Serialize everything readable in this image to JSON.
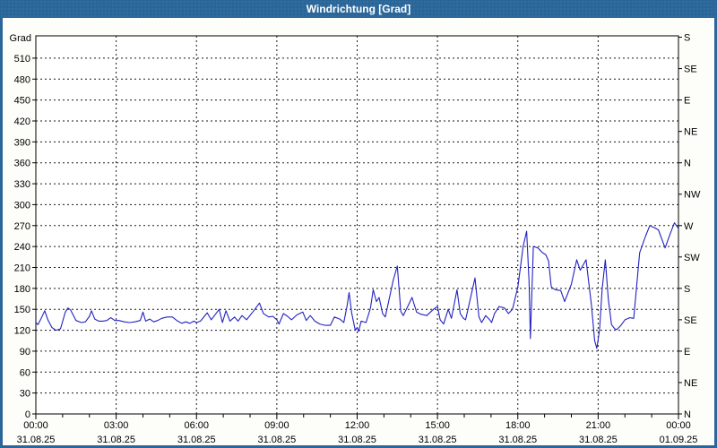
{
  "window": {
    "title": "Windrichtung [Grad]"
  },
  "colors": {
    "titlebar_bg": "#2a6699",
    "frame": "#2a6699",
    "background": "#fdfdf9",
    "plot_background": "#ffffff",
    "axis": "#000000",
    "grid": "#1a1a1a",
    "text": "#000000",
    "title_text": "#ffffff",
    "series": "#2222c0"
  },
  "chart_data": {
    "type": "line",
    "title": "Windrichtung [Grad]",
    "ylabel_left": "Grad",
    "ylim": [
      0,
      542
    ],
    "xlim_hours": [
      0,
      24
    ],
    "grid": "dashed",
    "y_ticks_left": [
      510,
      480,
      450,
      420,
      390,
      360,
      330,
      300,
      270,
      240,
      210,
      180,
      150,
      120,
      90,
      60,
      30,
      0
    ],
    "y_ticks_right": [
      {
        "deg": 540,
        "label": "S"
      },
      {
        "deg": 495,
        "label": "SE"
      },
      {
        "deg": 450,
        "label": "E"
      },
      {
        "deg": 405,
        "label": "NE"
      },
      {
        "deg": 360,
        "label": "N"
      },
      {
        "deg": 315,
        "label": "NW"
      },
      {
        "deg": 270,
        "label": "W"
      },
      {
        "deg": 225,
        "label": "SW"
      },
      {
        "deg": 180,
        "label": "S"
      },
      {
        "deg": 135,
        "label": "SE"
      },
      {
        "deg": 90,
        "label": "E"
      },
      {
        "deg": 45,
        "label": "NE"
      },
      {
        "deg": 0,
        "label": "N"
      }
    ],
    "x_major_ticks": [
      {
        "hour": 0,
        "time": "00:00",
        "date": "31.08.25"
      },
      {
        "hour": 3,
        "time": "03:00",
        "date": "31.08.25"
      },
      {
        "hour": 6,
        "time": "06:00",
        "date": "31.08.25"
      },
      {
        "hour": 9,
        "time": "09:00",
        "date": "31.08.25"
      },
      {
        "hour": 12,
        "time": "12:00",
        "date": "31.08.25"
      },
      {
        "hour": 15,
        "time": "15:00",
        "date": "31.08.25"
      },
      {
        "hour": 18,
        "time": "18:00",
        "date": "31.08.25"
      },
      {
        "hour": 21,
        "time": "21:00",
        "date": "31.08.25"
      },
      {
        "hour": 24,
        "time": "00:00",
        "date": "01.09.25"
      }
    ],
    "x_minor_interval_hours": 1,
    "series": [
      {
        "name": "Windrichtung [Grad]",
        "color": "#2222c0",
        "points": [
          [
            0.0,
            131
          ],
          [
            0.08,
            128
          ],
          [
            0.2,
            137
          ],
          [
            0.33,
            148
          ],
          [
            0.45,
            135
          ],
          [
            0.6,
            124
          ],
          [
            0.75,
            120
          ],
          [
            0.92,
            122
          ],
          [
            1.1,
            146
          ],
          [
            1.2,
            152
          ],
          [
            1.3,
            149
          ],
          [
            1.5,
            134
          ],
          [
            1.7,
            131
          ],
          [
            1.85,
            132
          ],
          [
            2.0,
            140
          ],
          [
            2.08,
            148
          ],
          [
            2.2,
            136
          ],
          [
            2.35,
            133
          ],
          [
            2.5,
            133
          ],
          [
            2.65,
            134
          ],
          [
            2.8,
            138
          ],
          [
            2.95,
            134
          ],
          [
            3.1,
            134
          ],
          [
            3.3,
            132
          ],
          [
            3.5,
            131
          ],
          [
            3.7,
            132
          ],
          [
            3.9,
            134
          ],
          [
            4.0,
            146
          ],
          [
            4.1,
            133
          ],
          [
            4.25,
            136
          ],
          [
            4.4,
            132
          ],
          [
            4.55,
            134
          ],
          [
            4.7,
            137
          ],
          [
            4.9,
            139
          ],
          [
            5.1,
            139
          ],
          [
            5.3,
            133
          ],
          [
            5.45,
            130
          ],
          [
            5.6,
            132
          ],
          [
            5.75,
            130
          ],
          [
            5.9,
            133
          ],
          [
            6.0,
            131
          ],
          [
            6.15,
            133
          ],
          [
            6.4,
            145
          ],
          [
            6.55,
            135
          ],
          [
            6.85,
            150
          ],
          [
            6.97,
            131
          ],
          [
            7.1,
            148
          ],
          [
            7.25,
            133
          ],
          [
            7.42,
            139
          ],
          [
            7.55,
            133
          ],
          [
            7.7,
            141
          ],
          [
            7.87,
            135
          ],
          [
            8.1,
            146
          ],
          [
            8.35,
            159
          ],
          [
            8.5,
            144
          ],
          [
            8.7,
            139
          ],
          [
            8.85,
            140
          ],
          [
            9.0,
            135
          ],
          [
            9.08,
            129
          ],
          [
            9.25,
            144
          ],
          [
            9.4,
            140
          ],
          [
            9.55,
            135
          ],
          [
            9.75,
            142
          ],
          [
            9.97,
            146
          ],
          [
            10.1,
            134
          ],
          [
            10.25,
            141
          ],
          [
            10.42,
            133
          ],
          [
            10.6,
            129
          ],
          [
            10.8,
            127
          ],
          [
            11.0,
            127
          ],
          [
            11.15,
            139
          ],
          [
            11.35,
            136
          ],
          [
            11.5,
            131
          ],
          [
            11.63,
            156
          ],
          [
            11.7,
            174
          ],
          [
            11.8,
            144
          ],
          [
            11.93,
            120
          ],
          [
            12.0,
            124
          ],
          [
            12.05,
            118
          ],
          [
            12.15,
            133
          ],
          [
            12.33,
            131
          ],
          [
            12.5,
            152
          ],
          [
            12.6,
            178
          ],
          [
            12.72,
            161
          ],
          [
            12.82,
            167
          ],
          [
            12.95,
            144
          ],
          [
            13.05,
            139
          ],
          [
            13.2,
            165
          ],
          [
            13.35,
            192
          ],
          [
            13.5,
            212
          ],
          [
            13.63,
            147
          ],
          [
            13.72,
            141
          ],
          [
            13.9,
            155
          ],
          [
            14.05,
            167
          ],
          [
            14.22,
            146
          ],
          [
            14.38,
            143
          ],
          [
            14.6,
            141
          ],
          [
            14.85,
            150
          ],
          [
            15.0,
            154
          ],
          [
            15.1,
            135
          ],
          [
            15.23,
            129
          ],
          [
            15.4,
            150
          ],
          [
            15.52,
            137
          ],
          [
            15.73,
            178
          ],
          [
            15.85,
            144
          ],
          [
            15.97,
            137
          ],
          [
            16.05,
            135
          ],
          [
            16.4,
            195
          ],
          [
            16.55,
            139
          ],
          [
            16.65,
            131
          ],
          [
            16.8,
            141
          ],
          [
            16.95,
            135
          ],
          [
            17.02,
            131
          ],
          [
            17.13,
            144
          ],
          [
            17.3,
            154
          ],
          [
            17.5,
            152
          ],
          [
            17.65,
            144
          ],
          [
            17.8,
            150
          ],
          [
            18.0,
            182
          ],
          [
            18.2,
            240
          ],
          [
            18.33,
            262
          ],
          [
            18.42,
            190
          ],
          [
            18.47,
            108
          ],
          [
            18.58,
            240
          ],
          [
            18.75,
            238
          ],
          [
            18.9,
            232
          ],
          [
            19.05,
            228
          ],
          [
            19.15,
            219
          ],
          [
            19.25,
            182
          ],
          [
            19.4,
            178
          ],
          [
            19.6,
            177
          ],
          [
            19.75,
            161
          ],
          [
            20.0,
            186
          ],
          [
            20.2,
            221
          ],
          [
            20.33,
            206
          ],
          [
            20.55,
            221
          ],
          [
            20.75,
            156
          ],
          [
            20.87,
            105
          ],
          [
            20.95,
            94
          ],
          [
            21.05,
            120
          ],
          [
            21.15,
            180
          ],
          [
            21.27,
            221
          ],
          [
            21.38,
            165
          ],
          [
            21.5,
            128
          ],
          [
            21.62,
            122
          ],
          [
            21.7,
            121
          ],
          [
            21.85,
            127
          ],
          [
            22.0,
            135
          ],
          [
            22.18,
            138
          ],
          [
            22.33,
            137
          ],
          [
            22.55,
            231
          ],
          [
            22.77,
            255
          ],
          [
            22.93,
            270
          ],
          [
            23.1,
            267
          ],
          [
            23.25,
            264
          ],
          [
            23.5,
            238
          ],
          [
            23.7,
            259
          ],
          [
            23.85,
            274
          ],
          [
            24.0,
            266
          ]
        ]
      }
    ]
  }
}
